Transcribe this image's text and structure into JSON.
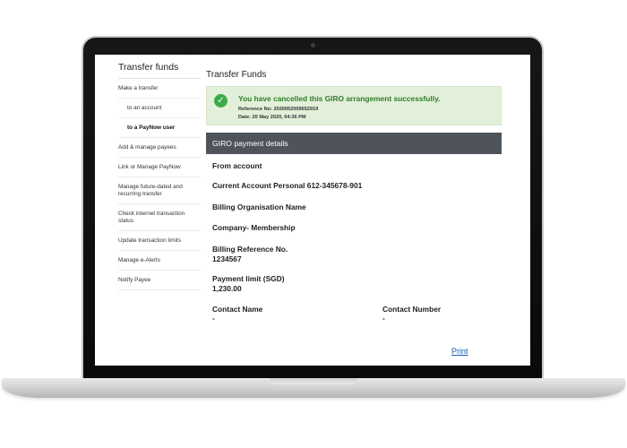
{
  "sidebar": {
    "title": "Transfer funds",
    "items": [
      {
        "label": "Make a transfer",
        "sub": false,
        "active": false
      },
      {
        "label": "to an account",
        "sub": true,
        "active": false
      },
      {
        "label": "to a PayNow user",
        "sub": true,
        "active": true
      },
      {
        "label": "Add & manage payees",
        "sub": false,
        "active": false
      },
      {
        "label": "Link or Manage PayNow",
        "sub": false,
        "active": false
      },
      {
        "label": "Manage future-dated and recurring transfer",
        "sub": false,
        "active": false
      },
      {
        "label": "Check internet transaction status",
        "sub": false,
        "active": false
      },
      {
        "label": "Update transaction limits",
        "sub": false,
        "active": false
      },
      {
        "label": "Manage e-Alerts",
        "sub": false,
        "active": false
      },
      {
        "label": "Notify Payee",
        "sub": false,
        "active": false
      }
    ]
  },
  "main": {
    "title": "Transfer Funds",
    "alert": {
      "message": "You have cancelled this GIRO arrangement successfully.",
      "reference": "Reference No: 2020052009652919",
      "date": "Date: 20 May 2020, 04:36 PM",
      "icon": "check-icon",
      "color": "#3cab4a"
    },
    "section_title": "GIRO payment details",
    "from_account_label": "From account",
    "from_account_value": "Current Account Personal 612-345678-901",
    "billing_org_label": "Billing Organisation Name",
    "billing_org_value": "Company- Membership",
    "billing_ref_label": "Billing Reference No.",
    "billing_ref_value": "1234567",
    "payment_limit_label": "Payment limit (SGD)",
    "payment_limit_value": "1,230.00",
    "contact_name_label": "Contact Name",
    "contact_name_value": "-",
    "contact_number_label": "Contact Number",
    "contact_number_value": "-",
    "print_label": "Print"
  }
}
